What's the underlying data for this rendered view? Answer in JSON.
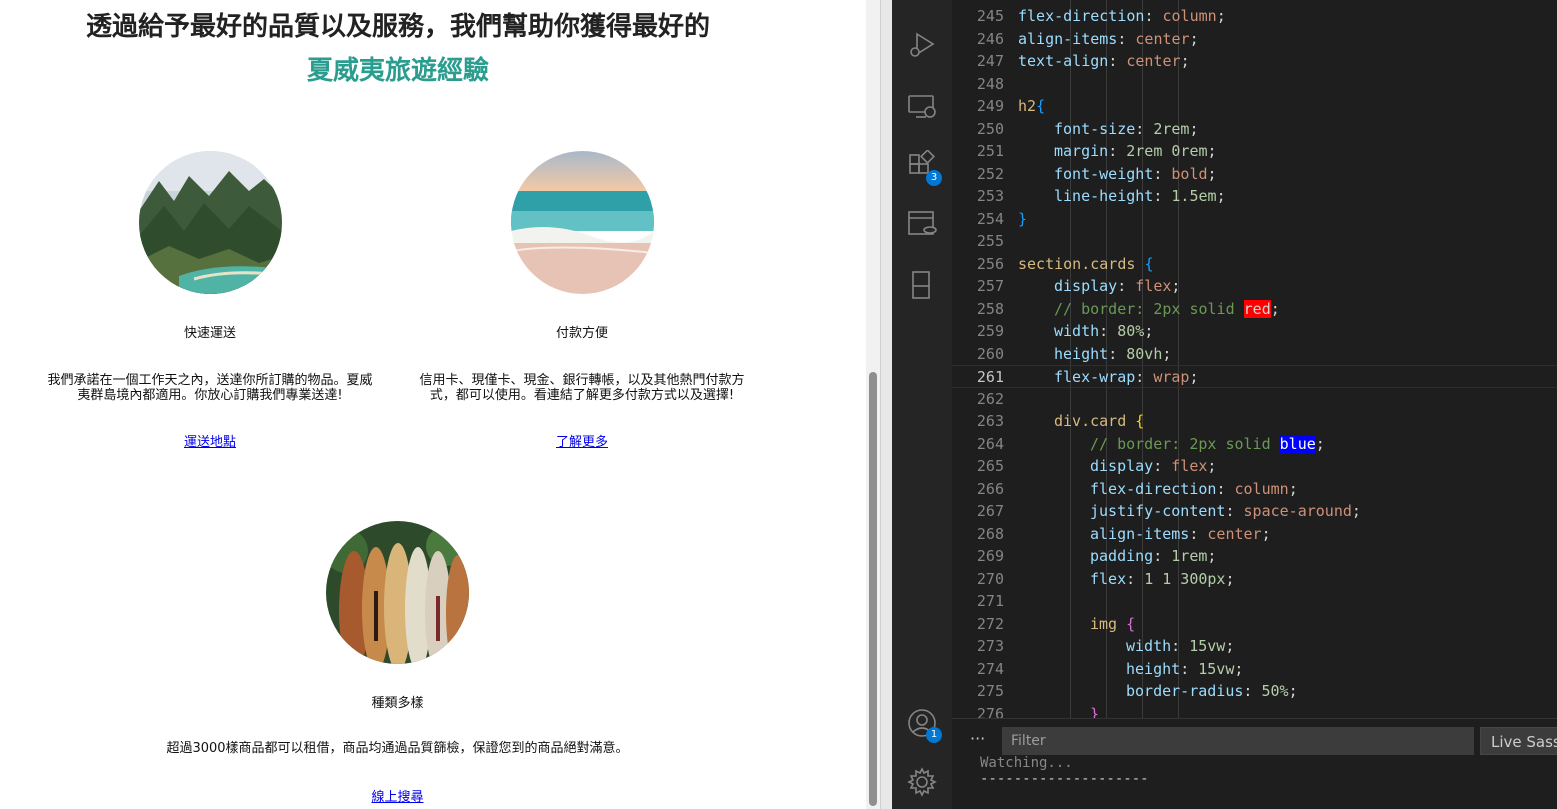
{
  "page": {
    "title_line1": "透過給予最好的品質以及服務，我們幫助你獲得最好的",
    "title_line2": "夏威夷旅遊經驗",
    "cards": [
      {
        "title": "快速運送",
        "desc": "我們承諾在一個工作天之內，送達你所訂購的物品。夏威夷群島境內都適用。你放心訂購我們專業送達!",
        "link": "運送地點",
        "image": "mountain-coast-photo"
      },
      {
        "title": "付款方便",
        "desc": "信用卡、現僅卡、現金、銀行轉帳，以及其他熱門付款方式，都可以使用。看連結了解更多付款方式以及選擇!",
        "link": "了解更多",
        "image": "beach-wave-photo"
      },
      {
        "title": "種類多樣",
        "desc": "超過3000樣商品都可以租借，商品均通過品質篩檢，保證您到的商品絕對滿意。",
        "link": "線上搜尋",
        "image": "surfboards-photo"
      }
    ]
  },
  "editor": {
    "active_line": "261",
    "lines": [
      {
        "n": "245",
        "indent": 2,
        "tokens": [
          [
            "prop",
            "flex-direction"
          ],
          [
            "punc",
            ": "
          ],
          [
            "val",
            "column"
          ],
          [
            "punc",
            ";"
          ]
        ]
      },
      {
        "n": "246",
        "indent": 2,
        "tokens": [
          [
            "prop",
            "align-items"
          ],
          [
            "punc",
            ": "
          ],
          [
            "val",
            "center"
          ],
          [
            "punc",
            ";"
          ]
        ]
      },
      {
        "n": "247",
        "indent": 2,
        "tokens": [
          [
            "prop",
            "text-align"
          ],
          [
            "punc",
            ": "
          ],
          [
            "val",
            "center"
          ],
          [
            "punc",
            ";"
          ]
        ]
      },
      {
        "n": "248",
        "indent": 0,
        "tokens": []
      },
      {
        "n": "249",
        "indent": 2,
        "tokens": [
          [
            "sel",
            "h2"
          ],
          [
            "brace",
            "{"
          ]
        ]
      },
      {
        "n": "250",
        "indent": 3,
        "tokens": [
          [
            "prop",
            "font-size"
          ],
          [
            "punc",
            ": "
          ],
          [
            "num",
            "2rem"
          ],
          [
            "punc",
            ";"
          ]
        ]
      },
      {
        "n": "251",
        "indent": 3,
        "tokens": [
          [
            "prop",
            "margin"
          ],
          [
            "punc",
            ": "
          ],
          [
            "num",
            "2rem 0rem"
          ],
          [
            "punc",
            ";"
          ]
        ]
      },
      {
        "n": "252",
        "indent": 3,
        "tokens": [
          [
            "prop",
            "font-weight"
          ],
          [
            "punc",
            ": "
          ],
          [
            "val",
            "bold"
          ],
          [
            "punc",
            ";"
          ]
        ]
      },
      {
        "n": "253",
        "indent": 3,
        "tokens": [
          [
            "prop",
            "line-height"
          ],
          [
            "punc",
            ": "
          ],
          [
            "num",
            "1.5em"
          ],
          [
            "punc",
            ";"
          ]
        ]
      },
      {
        "n": "254",
        "indent": 2,
        "tokens": [
          [
            "brace",
            "}"
          ]
        ]
      },
      {
        "n": "255",
        "indent": 0,
        "tokens": []
      },
      {
        "n": "256",
        "indent": 2,
        "tokens": [
          [
            "sel",
            "section.cards "
          ],
          [
            "brace",
            "{"
          ]
        ]
      },
      {
        "n": "257",
        "indent": 3,
        "tokens": [
          [
            "prop",
            "display"
          ],
          [
            "punc",
            ": "
          ],
          [
            "val",
            "flex"
          ],
          [
            "punc",
            ";"
          ]
        ]
      },
      {
        "n": "258",
        "indent": 3,
        "tokens": [
          [
            "comment",
            "// border: 2px solid "
          ],
          [
            "hlred",
            "red"
          ],
          [
            "punc",
            ";"
          ]
        ]
      },
      {
        "n": "259",
        "indent": 3,
        "tokens": [
          [
            "prop",
            "width"
          ],
          [
            "punc",
            ": "
          ],
          [
            "num",
            "80%"
          ],
          [
            "punc",
            ";"
          ]
        ]
      },
      {
        "n": "260",
        "indent": 3,
        "tokens": [
          [
            "prop",
            "height"
          ],
          [
            "punc",
            ": "
          ],
          [
            "num",
            "80vh"
          ],
          [
            "punc",
            ";"
          ]
        ]
      },
      {
        "n": "261",
        "indent": 3,
        "tokens": [
          [
            "prop",
            "flex-wrap"
          ],
          [
            "punc",
            ": "
          ],
          [
            "val",
            "wrap"
          ],
          [
            "punc",
            ";"
          ]
        ]
      },
      {
        "n": "262",
        "indent": 0,
        "tokens": []
      },
      {
        "n": "263",
        "indent": 3,
        "tokens": [
          [
            "sel",
            "div.card "
          ],
          [
            "brace2",
            "{"
          ]
        ]
      },
      {
        "n": "264",
        "indent": 4,
        "tokens": [
          [
            "comment",
            "// border: 2px solid "
          ],
          [
            "hlblue",
            "blue"
          ],
          [
            "punc",
            ";"
          ]
        ]
      },
      {
        "n": "265",
        "indent": 4,
        "tokens": [
          [
            "prop",
            "display"
          ],
          [
            "punc",
            ": "
          ],
          [
            "val",
            "flex"
          ],
          [
            "punc",
            ";"
          ]
        ]
      },
      {
        "n": "266",
        "indent": 4,
        "tokens": [
          [
            "prop",
            "flex-direction"
          ],
          [
            "punc",
            ": "
          ],
          [
            "val",
            "column"
          ],
          [
            "punc",
            ";"
          ]
        ]
      },
      {
        "n": "267",
        "indent": 4,
        "tokens": [
          [
            "prop",
            "justify-content"
          ],
          [
            "punc",
            ": "
          ],
          [
            "val",
            "space-around"
          ],
          [
            "punc",
            ";"
          ]
        ]
      },
      {
        "n": "268",
        "indent": 4,
        "tokens": [
          [
            "prop",
            "align-items"
          ],
          [
            "punc",
            ": "
          ],
          [
            "val",
            "center"
          ],
          [
            "punc",
            ";"
          ]
        ]
      },
      {
        "n": "269",
        "indent": 4,
        "tokens": [
          [
            "prop",
            "padding"
          ],
          [
            "punc",
            ": "
          ],
          [
            "num",
            "1rem"
          ],
          [
            "punc",
            ";"
          ]
        ]
      },
      {
        "n": "270",
        "indent": 4,
        "tokens": [
          [
            "prop",
            "flex"
          ],
          [
            "punc",
            ": "
          ],
          [
            "num",
            "1 1 300px"
          ],
          [
            "punc",
            ";"
          ]
        ]
      },
      {
        "n": "271",
        "indent": 0,
        "tokens": []
      },
      {
        "n": "272",
        "indent": 4,
        "tokens": [
          [
            "tag",
            "img "
          ],
          [
            "brace3",
            "{"
          ]
        ]
      },
      {
        "n": "273",
        "indent": 5,
        "tokens": [
          [
            "prop",
            "width"
          ],
          [
            "punc",
            ": "
          ],
          [
            "num",
            "15vw"
          ],
          [
            "punc",
            ";"
          ]
        ]
      },
      {
        "n": "274",
        "indent": 5,
        "tokens": [
          [
            "prop",
            "height"
          ],
          [
            "punc",
            ": "
          ],
          [
            "num",
            "15vw"
          ],
          [
            "punc",
            ";"
          ]
        ]
      },
      {
        "n": "275",
        "indent": 5,
        "tokens": [
          [
            "prop",
            "border-radius"
          ],
          [
            "punc",
            ": "
          ],
          [
            "num",
            "50%"
          ],
          [
            "punc",
            ";"
          ]
        ]
      },
      {
        "n": "276",
        "indent": 4,
        "tokens": [
          [
            "brace3",
            "}"
          ]
        ]
      }
    ]
  },
  "activity": {
    "icons": [
      "run-debug-icon",
      "remote-explorer-icon",
      "extensions-icon",
      "database-icon",
      "bookmark-icon",
      "account-icon",
      "settings-gear-icon"
    ],
    "extensions_badge": "3",
    "account_badge": "1"
  },
  "panel": {
    "dots": "···",
    "filter_placeholder": "Filter",
    "live_sass_label": "Live Sass",
    "output_line1": "Watching...",
    "output_line2": "--------------------"
  },
  "colors": {
    "accent_teal": "#2a9d8f",
    "link_blue": "#0000ee",
    "editor_bg": "#1e1e1e",
    "activity_bg": "#252526",
    "badge_blue": "#0078d4"
  }
}
